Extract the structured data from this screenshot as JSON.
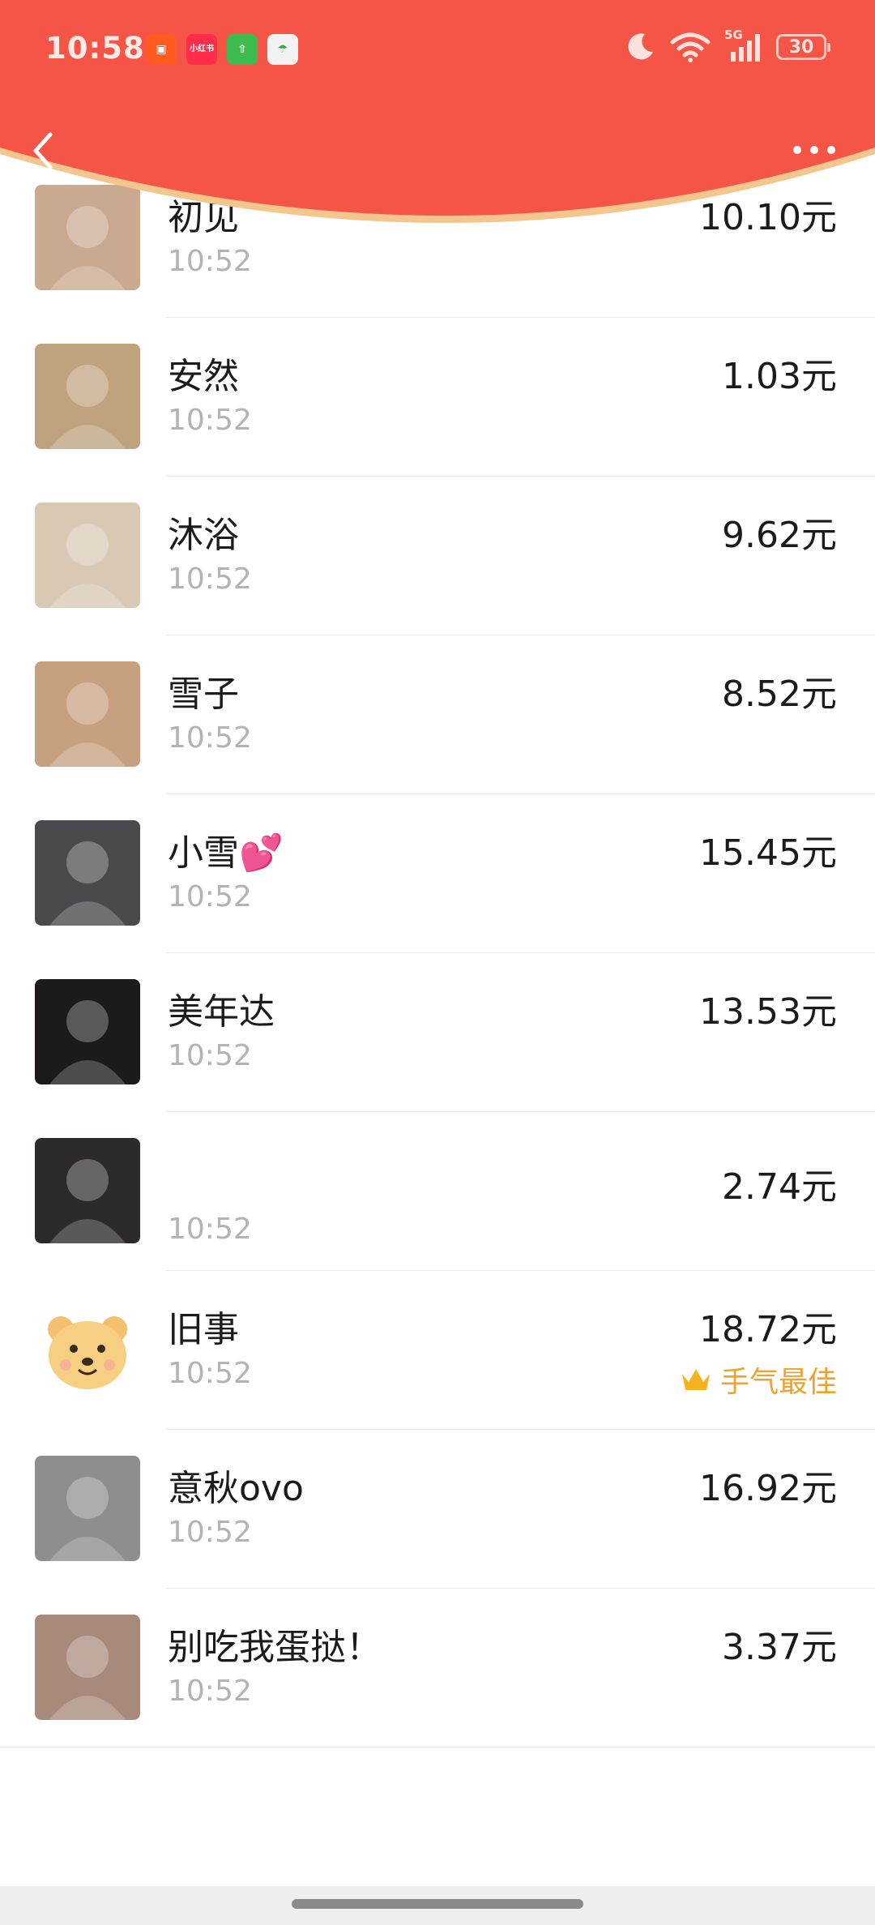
{
  "status_bar": {
    "time": "10:58",
    "notification_icons": [
      {
        "name": "kuaishou-app-icon",
        "color": "#ff5a1f",
        "glyph": "▣"
      },
      {
        "name": "xiaohongshu-app-icon",
        "color": "#ff2d49",
        "glyph": "小红书"
      },
      {
        "name": "upload-app-icon",
        "color": "#3dbb4e",
        "glyph": "⇧"
      },
      {
        "name": "umbrella-app-icon",
        "color": "#f2f2f2",
        "glyph": "☂"
      }
    ],
    "network": "5G",
    "battery": "30"
  },
  "colors": {
    "header_red": "#f45546",
    "header_edge": "#f4c58d",
    "best_gold": "#f0a22e"
  },
  "records": [
    {
      "name": "初见",
      "time": "10:52",
      "amount": "10.10元",
      "avatar_color": "#c9a98f",
      "partial": true
    },
    {
      "name": "安然",
      "time": "10:52",
      "amount": "1.03元",
      "avatar_color": "#bfa37e"
    },
    {
      "name": "沐浴",
      "time": "10:52",
      "amount": "9.62元",
      "avatar_color": "#d8c8b4"
    },
    {
      "name": "雪子",
      "time": "10:52",
      "amount": "8.52元",
      "avatar_color": "#c7a080"
    },
    {
      "name": "小雪💕",
      "time": "10:52",
      "amount": "15.45元",
      "avatar_color": "#4a4a4e"
    },
    {
      "name": "美年达",
      "time": "10:52",
      "amount": "13.53元",
      "avatar_color": "#1e1a1c"
    },
    {
      "name": "",
      "time": "10:52",
      "amount": "2.74元",
      "avatar_color": "#2e2a2c"
    },
    {
      "name": "旧事",
      "time": "10:52",
      "amount": "18.72元",
      "avatar_color": "#ffffff",
      "best": "手气最佳",
      "avatar_type": "bear"
    },
    {
      "name": "意秋ovo",
      "time": "10:52",
      "amount": "16.92元",
      "avatar_color": "#8e8e8e"
    },
    {
      "name": "别吃我蛋挞！",
      "time": "10:52",
      "amount": "3.37元",
      "avatar_color": "#a88a7a"
    }
  ]
}
